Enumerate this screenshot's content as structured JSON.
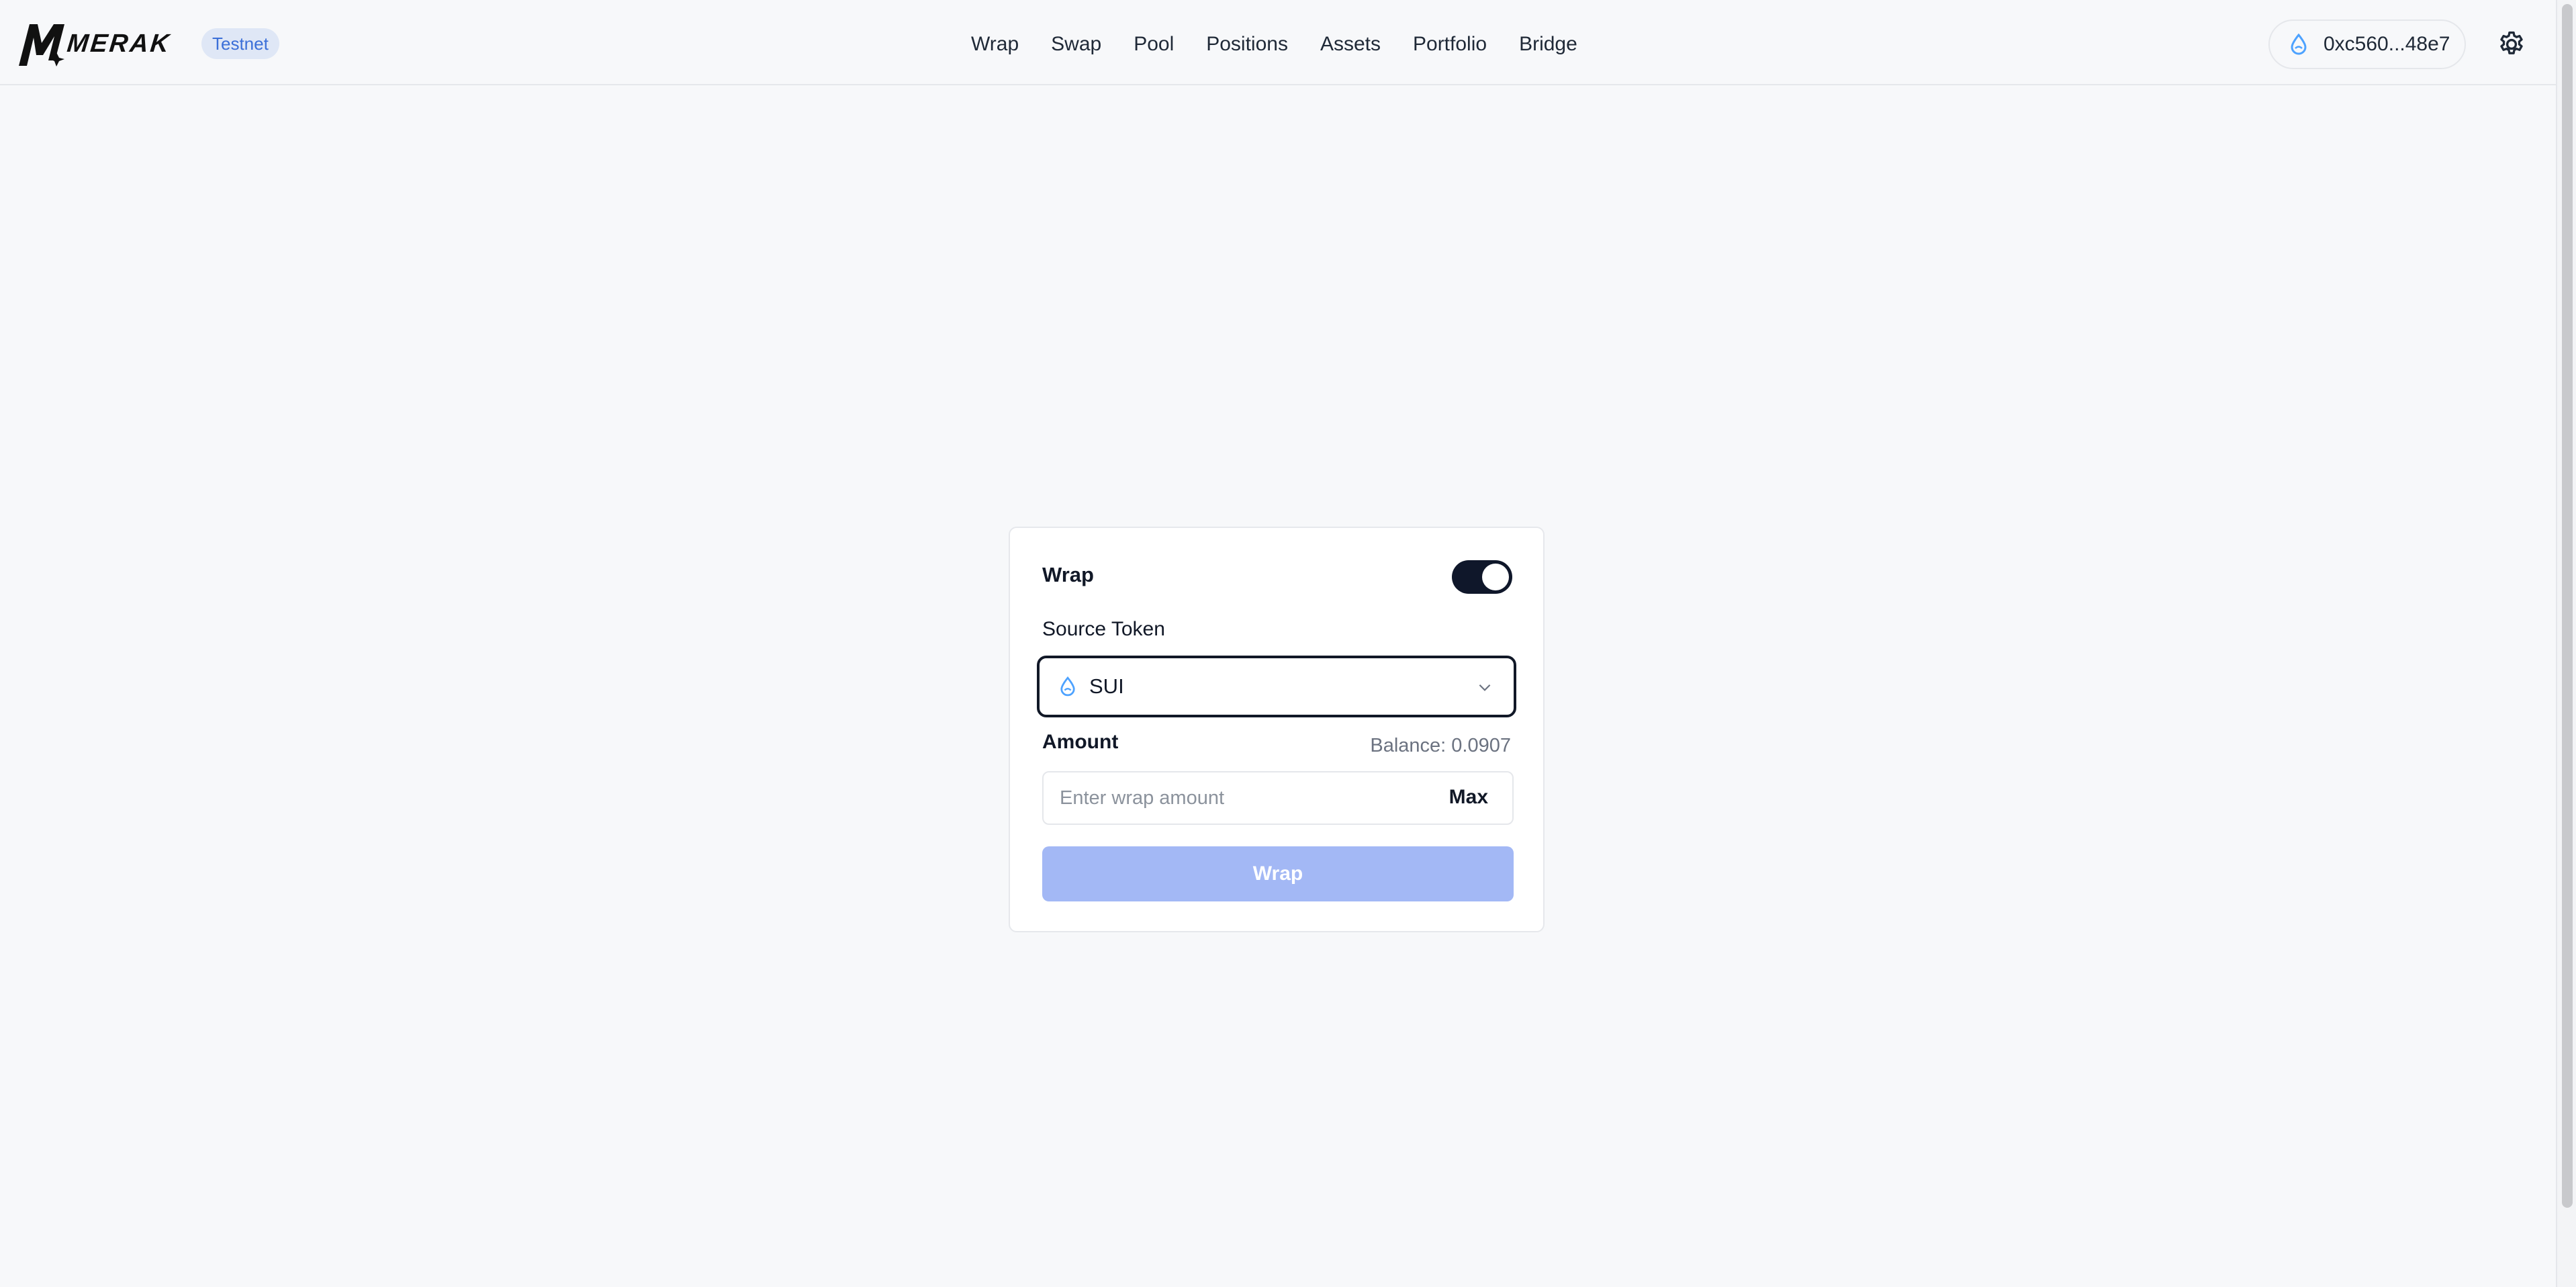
{
  "header": {
    "logo_text": "MERAK",
    "network_badge": "Testnet",
    "nav": [
      "Wrap",
      "Swap",
      "Pool",
      "Positions",
      "Assets",
      "Portfolio",
      "Bridge"
    ],
    "wallet_address": "0xc560...48e7"
  },
  "card": {
    "wrap_label": "Wrap",
    "wrap_toggle_on": true,
    "source_token_label": "Source Token",
    "selected_token": "SUI",
    "amount_label": "Amount",
    "balance_text": "Balance: 0.0907",
    "amount_placeholder": "Enter wrap amount",
    "amount_value": "",
    "max_label": "Max",
    "submit_label": "Wrap"
  },
  "colors": {
    "accent": "#a3b8f5",
    "badge_bg": "#dfe7f6",
    "badge_text": "#3b6fd8",
    "sui_blue": "#4da2ff",
    "toggle_on": "#0f172a"
  },
  "icons": {
    "token": "sui-drop-icon",
    "wallet": "sui-drop-icon",
    "dropdown": "chevron-down-icon",
    "settings": "gear-icon"
  }
}
